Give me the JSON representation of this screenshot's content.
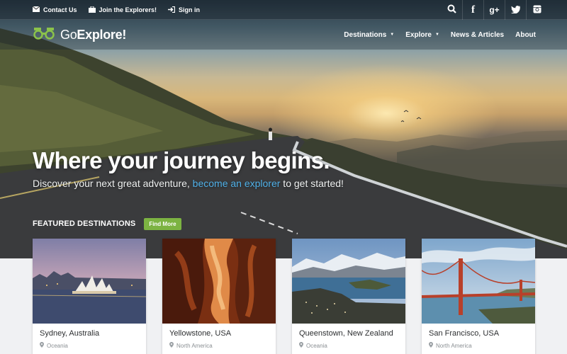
{
  "topbar": {
    "links": [
      {
        "label": "Contact Us",
        "icon": "envelope-icon"
      },
      {
        "label": "Join the Explorers!",
        "icon": "briefcase-icon"
      },
      {
        "label": "Sign in",
        "icon": "sign-in-icon"
      }
    ],
    "social": [
      "search-icon",
      "facebook-icon",
      "google-plus-icon",
      "twitter-icon",
      "instagram-icon"
    ]
  },
  "logo": {
    "prefix": "Go",
    "bold": "Explore!",
    "icon": "binoculars-icon"
  },
  "nav": {
    "items": [
      {
        "label": "Destinations",
        "dropdown": true
      },
      {
        "label": "Explore",
        "dropdown": true
      },
      {
        "label": "News & Articles",
        "dropdown": false
      },
      {
        "label": "About",
        "dropdown": false
      }
    ]
  },
  "hero": {
    "headline": "Where your journey begins.",
    "sub_before": "Discover your next great adventure, ",
    "sub_link": "become an explorer",
    "sub_after": " to get started!"
  },
  "featured": {
    "title": "FEATURED DESTINATIONS",
    "button": "Find More"
  },
  "cards": [
    {
      "title": "Sydney, Australia",
      "region": "Oceania"
    },
    {
      "title": "Yellowstone, USA",
      "region": "North America"
    },
    {
      "title": "Queenstown, New Zealand",
      "region": "Oceania"
    },
    {
      "title": "San Francisco, USA",
      "region": "North America"
    }
  ],
  "colors": {
    "accent_green": "#7cb342",
    "link_blue": "#4fb0e8",
    "logo_green": "#8bc34a"
  }
}
